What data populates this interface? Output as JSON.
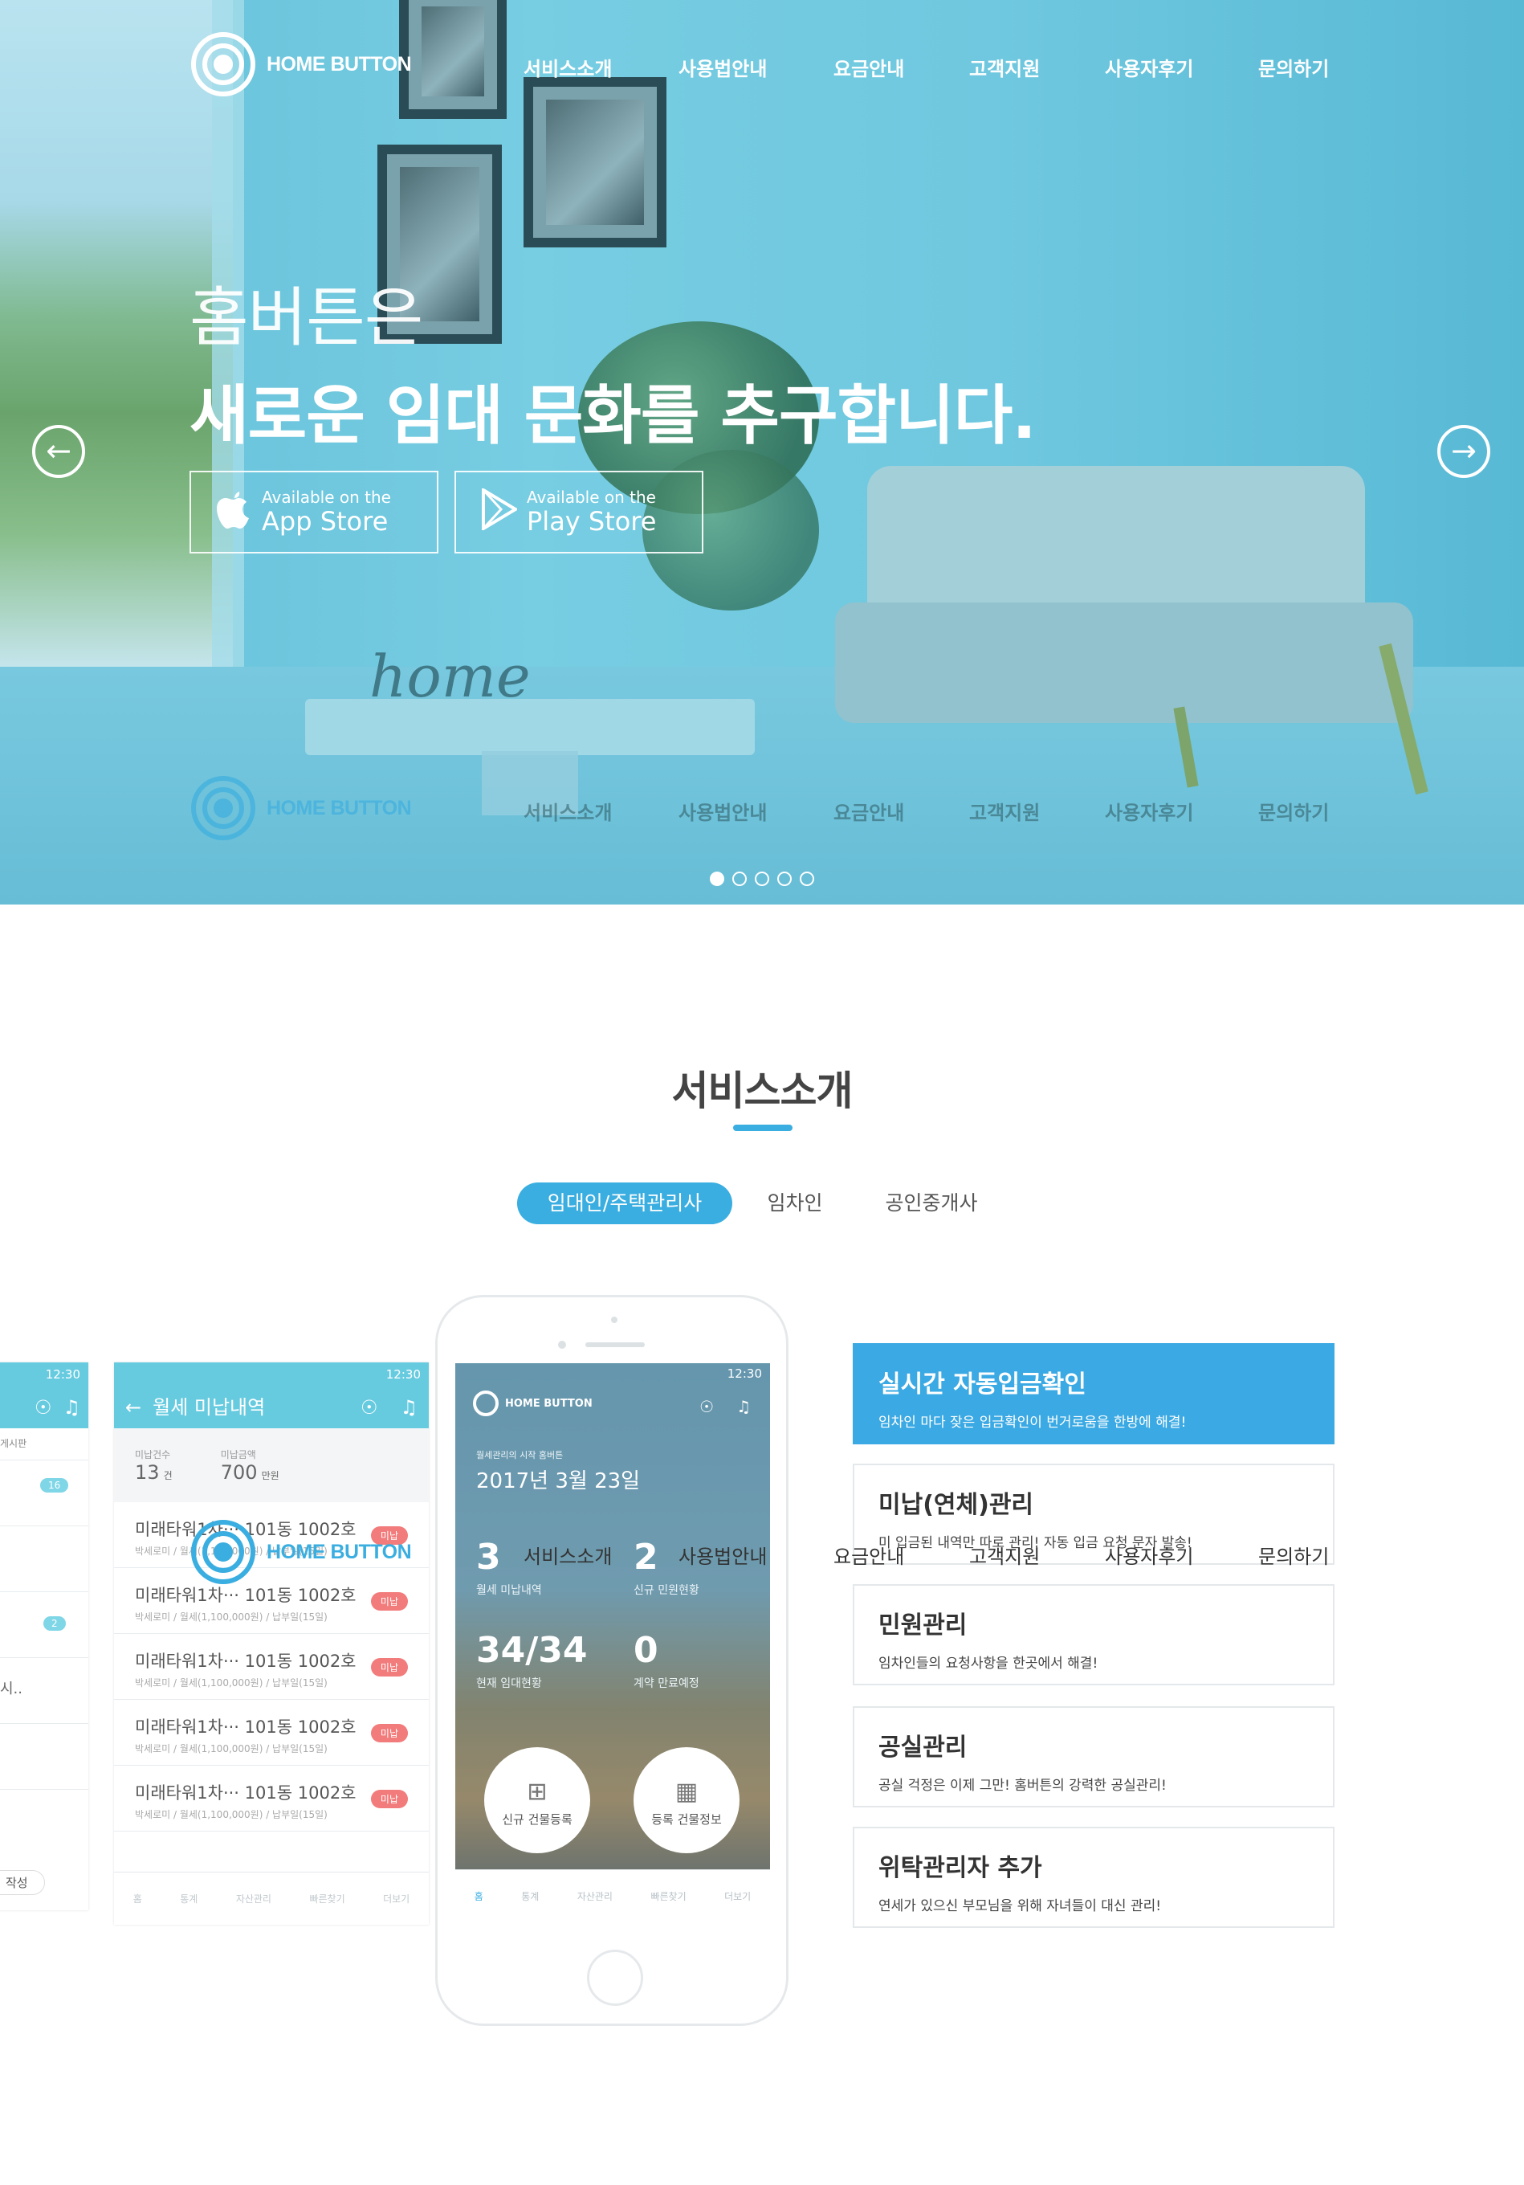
{
  "brand": {
    "name": "HOME BUTTON"
  },
  "nav": {
    "items": [
      "서비스소개",
      "사용법안내",
      "요금안내",
      "고객지원",
      "사용자후기",
      "문의하기"
    ]
  },
  "hero": {
    "line1": "홈버튼은",
    "line2": "새로운 임대 문화를 추구합니다.",
    "app_store": {
      "small": "Available on the",
      "big": "App Store"
    },
    "play_store": {
      "small": "Available on the",
      "big": "Play Store"
    },
    "decor_text": "home",
    "slides": 5,
    "active_slide": 1
  },
  "service": {
    "title": "서비스소개",
    "tabs": [
      {
        "label": "임대인/주택관리사",
        "active": true
      },
      {
        "label": "임차인",
        "active": false
      },
      {
        "label": "공인중개사",
        "active": false
      }
    ]
  },
  "left_screen": {
    "time": "12:30",
    "title": "월세 미납내역",
    "count_label": "미납건수",
    "count_value": "13",
    "count_unit": "건",
    "amount_label": "미납금액",
    "amount_value": "700",
    "amount_unit": "만원",
    "rows": [
      {
        "title": "미래타워1차··· 101동 1002호",
        "sub": "박세로미 / 월세(1,100,000원) / 납부일(15일)",
        "badge": "미납"
      },
      {
        "title": "미래타워1차··· 101동 1002호",
        "sub": "박세로미 / 월세(1,100,000원) / 납부일(15일)",
        "badge": "미납"
      },
      {
        "title": "미래타워1차··· 101동 1002호",
        "sub": "박세로미 / 월세(1,100,000원) / 납부일(15일)",
        "badge": "미납"
      },
      {
        "title": "미래타워1차··· 101동 1002호",
        "sub": "박세로미 / 월세(1,100,000원) / 납부일(15일)",
        "badge": "미납"
      },
      {
        "title": "미래타워1차··· 101동 1002호",
        "sub": "박세로미 / 월세(1,100,000원) / 납부일(15일)",
        "badge": "미납"
      }
    ],
    "tabbar": [
      "홈",
      "통계",
      "자산관리",
      "빠른찾기",
      "더보기"
    ]
  },
  "far_left_screen": {
    "time": "12:30",
    "label_top": "게시판",
    "badge1": "16",
    "badge2": "2",
    "text_sample": "시..",
    "button": "작성"
  },
  "phone_screen": {
    "time": "12:30",
    "brand": "HOME BUTTON",
    "subtitle": "월세관리의 시작 홈버튼",
    "date": "2017년 3월 23일",
    "stats": [
      {
        "value": "3",
        "label": "월세 미납내역"
      },
      {
        "value": "2",
        "label": "신규 민원현황"
      },
      {
        "value": "34/34",
        "label": "현재 임대현황"
      },
      {
        "value": "0",
        "label": "계약 만료예정"
      }
    ],
    "btn_new": "신규 건물등록",
    "btn_info": "등록 건물정보",
    "tabbar": [
      "홈",
      "통계",
      "자산관리",
      "빠른찾기",
      "더보기"
    ]
  },
  "features": [
    {
      "title": "실시간 자동입금확인",
      "desc": "임차인 마다 잦은 입금확인이 번거로움을 한방에 해결!",
      "active": true
    },
    {
      "title": "미납(연체)관리",
      "desc": "미 입금된 내역만 따로 관리! 자동 입금 요청 문자 발송!",
      "active": false
    },
    {
      "title": "민원관리",
      "desc": "임차인들의 요청사항을 한곳에서 해결!",
      "active": false
    },
    {
      "title": "공실관리",
      "desc": "공실 걱정은 이제 그만! 홈버튼의 강력한 공실관리!",
      "active": false
    },
    {
      "title": "위탁관리자 추가",
      "desc": "연세가 있으신 부모님을 위해 자녀들이 대신 관리!",
      "active": false
    }
  ],
  "colors": {
    "accent": "#3aaee0",
    "hero_tint": "#6fc8df",
    "badge": "#f27b7b"
  }
}
